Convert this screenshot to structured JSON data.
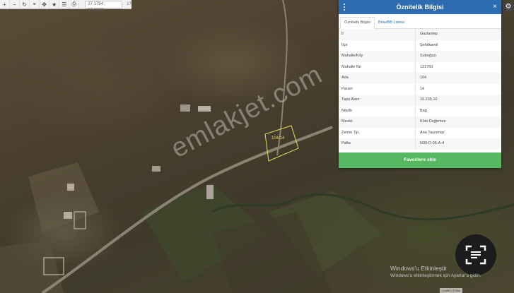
{
  "toolbar": {
    "buttons": [
      {
        "name": "zoom-in-button",
        "icon": "plus-icon",
        "glyph": "+"
      },
      {
        "name": "zoom-out-button",
        "icon": "minus-icon",
        "glyph": "−"
      },
      {
        "name": "refresh-button",
        "icon": "refresh-icon",
        "glyph": "↻"
      },
      {
        "name": "locate-button",
        "icon": "crosshair-icon",
        "glyph": "⌖"
      },
      {
        "name": "measure-button",
        "icon": "ruler-icon",
        "glyph": "✥"
      },
      {
        "name": "favorite-button",
        "icon": "star-icon",
        "glyph": "★"
      },
      {
        "name": "menu-button",
        "icon": "list-icon",
        "glyph": "☰"
      },
      {
        "name": "print-button",
        "icon": "printer-icon",
        "glyph": "⎙"
      }
    ],
    "coordinates": "37.1794 , 37.0050",
    "extra": "17"
  },
  "panel": {
    "title": "Öznitelik Bilgisi",
    "close_glyph": "×",
    "tabs": [
      "Öznitelik Bilgisi",
      "Bina/BB Listesi"
    ],
    "rows": [
      {
        "key": "İl",
        "value": "Gaziantep"
      },
      {
        "key": "İlçe",
        "value": "Şehitkamil"
      },
      {
        "key": "Mahalle/Köy",
        "value": "Suboğazı"
      },
      {
        "key": "Mahalle No",
        "value": "131760"
      },
      {
        "key": "Ada",
        "value": "104"
      },
      {
        "key": "Parsel",
        "value": "14"
      },
      {
        "key": "Tapu Alanı",
        "value": "10.235,10"
      },
      {
        "key": "Nitelik",
        "value": "Bağ"
      },
      {
        "key": "Mevkii",
        "value": "Kötü Değirmen"
      },
      {
        "key": "Zemin Tip",
        "value": "Ana Taşınmaz"
      },
      {
        "key": "Pafta",
        "value": "N39-D-06-A-4"
      }
    ],
    "favorite_button": "Favorilere ekle"
  },
  "map": {
    "parcel_label": "104/14",
    "watermark": "emlakjet.com",
    "settings_glyph": "⚙"
  },
  "windows_notice": {
    "title": "Windows'u Etkinleştir",
    "subtitle": "Windows'u etkinleştirmek için Ayarlar'a gidin."
  },
  "attribution": "Leaflet | © Esri",
  "colors": {
    "header_blue": "#2d6cb0",
    "favorite_green": "#56b861",
    "parcel_outline": "#e8dc5a"
  }
}
